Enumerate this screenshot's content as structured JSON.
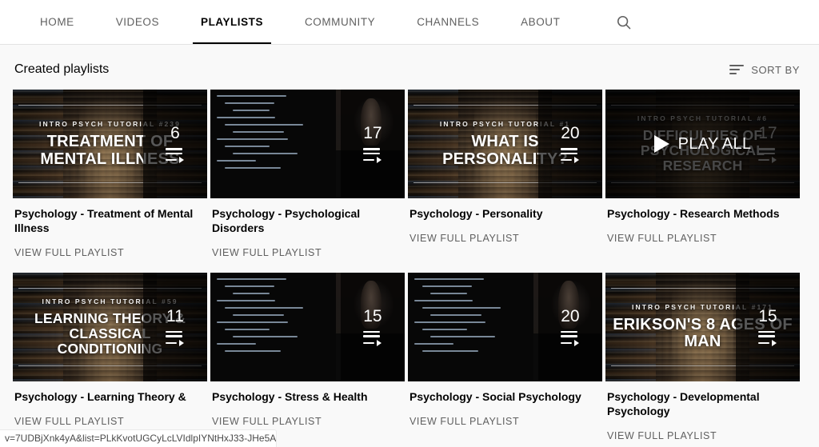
{
  "nav": {
    "tabs": [
      {
        "label": "HOME",
        "active": false
      },
      {
        "label": "VIDEOS",
        "active": false
      },
      {
        "label": "PLAYLISTS",
        "active": true
      },
      {
        "label": "COMMUNITY",
        "active": false
      },
      {
        "label": "CHANNELS",
        "active": false
      },
      {
        "label": "ABOUT",
        "active": false
      }
    ],
    "search_icon": "search-icon"
  },
  "section": {
    "title": "Created playlists",
    "sort_label": "SORT BY",
    "sort_icon": "sort-lines-icon"
  },
  "colors": {
    "page_background": "#f9f9f9",
    "nav_background": "#ffffff",
    "primary_text": "#030303",
    "secondary_text": "#606060",
    "active_underline": "#030303",
    "overlay": "rgba(0,0,0,0.72)"
  },
  "playlists": [
    {
      "title": "Psychology - Treatment of Mental Illness",
      "link_label": "VIEW FULL PLAYLIST",
      "count": "6",
      "thumb_style": "library",
      "kicker": "INTRO PSYCH TUTORIAL #239",
      "headline": "TREATMENT OF MENTAL ILLNESS",
      "hovered": false
    },
    {
      "title": "Psychology - Psychological Disorders",
      "link_label": "VIEW FULL PLAYLIST",
      "count": "17",
      "thumb_style": "board",
      "kicker": "",
      "headline": "",
      "hovered": false
    },
    {
      "title": "Psychology - Personality",
      "link_label": "VIEW FULL PLAYLIST",
      "count": "20",
      "thumb_style": "library",
      "kicker": "INTRO PSYCH TUTORIAL #1",
      "headline": "WHAT IS PERSONALITY?",
      "hovered": false
    },
    {
      "title": "Psychology - Research Methods",
      "link_label": "VIEW FULL PLAYLIST",
      "count": "17",
      "thumb_style": "library",
      "kicker": "INTRO PSYCH TUTORIAL #6",
      "headline": "DIFFICULTIES OF PSYCHOLOGICAL RESEARCH",
      "hovered": true,
      "play_all_label": "PLAY ALL"
    },
    {
      "title": "Psychology - Learning Theory &",
      "link_label": "VIEW FULL PLAYLIST",
      "count": "11",
      "thumb_style": "library",
      "kicker": "INTRO PSYCH TUTORIAL #59",
      "headline": "LEARNING THEORY & CLASSICAL CONDITIONING",
      "hovered": false
    },
    {
      "title": "Psychology - Stress & Health",
      "link_label": "VIEW FULL PLAYLIST",
      "count": "15",
      "thumb_style": "board",
      "kicker": "",
      "headline": "",
      "hovered": false
    },
    {
      "title": "Psychology - Social Psychology",
      "link_label": "VIEW FULL PLAYLIST",
      "count": "20",
      "thumb_style": "board",
      "kicker": "",
      "headline": "",
      "hovered": false
    },
    {
      "title": "Psychology - Developmental Psychology",
      "link_label": "VIEW FULL PLAYLIST",
      "count": "15",
      "thumb_style": "library",
      "kicker": "INTRO PSYCH TUTORIAL #171",
      "headline": "ERIKSON'S 8 AGES OF MAN",
      "hovered": false
    }
  ],
  "status_bar": {
    "url": "v=7UDBjXnk4yA&list=PLkKvotUGCyLcLVIdlpIYNtHxJ33-JHe5A"
  }
}
